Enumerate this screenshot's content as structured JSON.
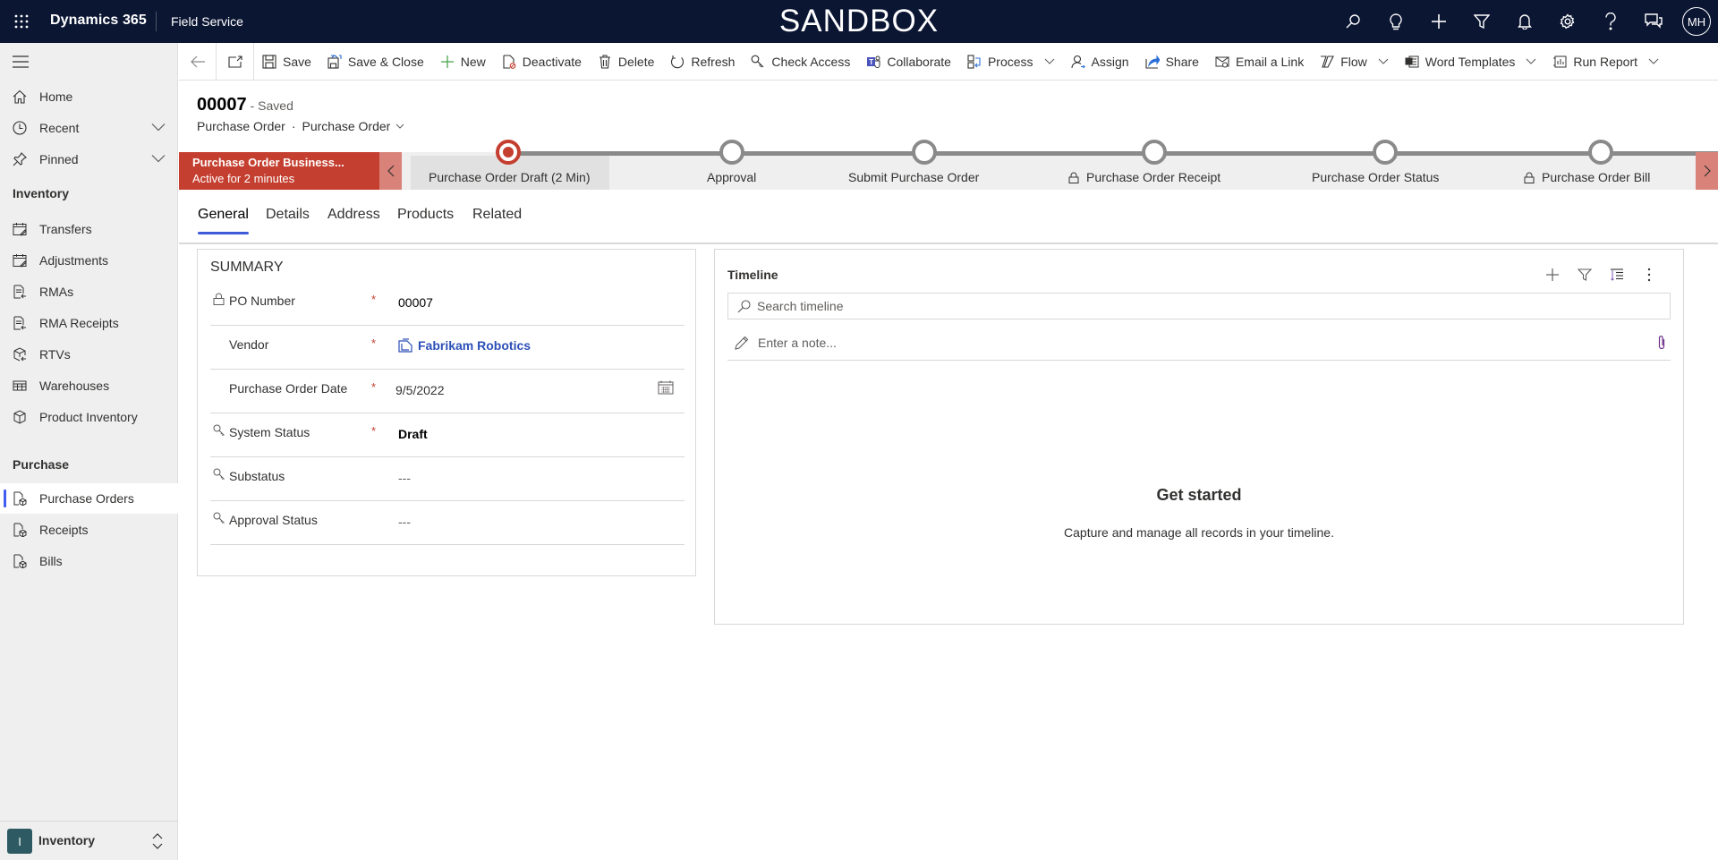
{
  "topbar": {
    "brand": "Dynamics 365",
    "app_name": "Field Service",
    "environment_banner": "SANDBOX",
    "icons": [
      "search-icon",
      "lightbulb-icon",
      "plus-icon",
      "filter-icon",
      "bell-icon",
      "gear-icon",
      "help-icon",
      "chat-icon"
    ],
    "avatar_initials": "MH",
    "background_color": "#0b1633"
  },
  "sidebar": {
    "top_items": [
      {
        "label": "Home",
        "icon": "home-icon"
      },
      {
        "label": "Recent",
        "icon": "clock-icon",
        "expandable": true
      },
      {
        "label": "Pinned",
        "icon": "pin-icon",
        "expandable": true
      }
    ],
    "groups": [
      {
        "title": "Inventory",
        "items": [
          {
            "label": "Transfers",
            "icon": "calendar-edit-icon"
          },
          {
            "label": "Adjustments",
            "icon": "calendar-edit-icon"
          },
          {
            "label": "RMAs",
            "icon": "document-return-icon"
          },
          {
            "label": "RMA Receipts",
            "icon": "document-return-icon"
          },
          {
            "label": "RTVs",
            "icon": "box-return-icon"
          },
          {
            "label": "Warehouses",
            "icon": "warehouse-icon"
          },
          {
            "label": "Product Inventory",
            "icon": "box-icon"
          }
        ]
      },
      {
        "title": "Purchase",
        "items": [
          {
            "label": "Purchase Orders",
            "icon": "document-box-icon",
            "active": true
          },
          {
            "label": "Receipts",
            "icon": "document-box-icon"
          },
          {
            "label": "Bills",
            "icon": "document-box-icon"
          }
        ]
      }
    ],
    "area_switcher": {
      "badge": "I",
      "label": "Inventory"
    }
  },
  "commandbar": {
    "items": [
      {
        "label": "Save",
        "icon": "save-icon"
      },
      {
        "label": "Save & Close",
        "icon": "save-close-icon"
      },
      {
        "label": "New",
        "icon": "plus-icon"
      },
      {
        "label": "Deactivate",
        "icon": "deactivate-icon"
      },
      {
        "label": "Delete",
        "icon": "trash-icon"
      },
      {
        "label": "Refresh",
        "icon": "refresh-icon"
      },
      {
        "label": "Check Access",
        "icon": "key-icon"
      },
      {
        "label": "Collaborate",
        "icon": "teams-icon"
      },
      {
        "label": "Process",
        "icon": "process-icon",
        "dropdown": true
      },
      {
        "label": "Assign",
        "icon": "assign-icon"
      },
      {
        "label": "Share",
        "icon": "share-icon"
      },
      {
        "label": "Email a Link",
        "icon": "email-link-icon"
      },
      {
        "label": "Flow",
        "icon": "flow-icon",
        "dropdown": true
      },
      {
        "label": "Word Templates",
        "icon": "word-icon",
        "dropdown": true
      },
      {
        "label": "Run Report",
        "icon": "report-icon",
        "dropdown": true
      }
    ]
  },
  "record": {
    "title": "00007",
    "save_status": "- Saved",
    "entity": "Purchase Order",
    "separator": "·",
    "form": "Purchase Order"
  },
  "bpf": {
    "name": "Purchase Order Business...",
    "active_for": "Active for 2 minutes",
    "accent_color": "#c43f2f",
    "stages": [
      {
        "label": "Purchase Order Draft  (2 Min)",
        "current": true,
        "locked": false
      },
      {
        "label": "Approval",
        "current": false,
        "locked": false
      },
      {
        "label": "Submit Purchase Order",
        "current": false,
        "locked": false
      },
      {
        "label": "Purchase Order Receipt",
        "current": false,
        "locked": true
      },
      {
        "label": "Purchase Order Status",
        "current": false,
        "locked": false
      },
      {
        "label": "Purchase Order Bill",
        "current": false,
        "locked": true
      }
    ]
  },
  "tabs": [
    {
      "label": "General",
      "active": true
    },
    {
      "label": "Details",
      "active": false
    },
    {
      "label": "Address",
      "active": false
    },
    {
      "label": "Products",
      "active": false
    },
    {
      "label": "Related",
      "active": false
    }
  ],
  "summary": {
    "title": "SUMMARY",
    "required_marker": "*",
    "fields": [
      {
        "label": "PO Number",
        "icon": "lock-icon",
        "required": true,
        "value": "00007"
      },
      {
        "label": "Vendor",
        "icon": null,
        "required": true,
        "value": "Fabrikam Robotics",
        "is_lookup": true
      },
      {
        "label": "Purchase Order Date",
        "icon": null,
        "required": true,
        "value": "9/5/2022",
        "has_calendar": true
      },
      {
        "label": "System Status",
        "icon": "key-icon",
        "required": true,
        "value": "Draft"
      },
      {
        "label": "Substatus",
        "icon": "key-icon",
        "required": false,
        "value": "---"
      },
      {
        "label": "Approval Status",
        "icon": "key-icon",
        "required": false,
        "value": "---"
      }
    ]
  },
  "timeline": {
    "title": "Timeline",
    "search_placeholder": "Search timeline",
    "note_placeholder": "Enter a note...",
    "empty_title": "Get started",
    "empty_subtitle": "Capture and manage all records in your timeline."
  }
}
